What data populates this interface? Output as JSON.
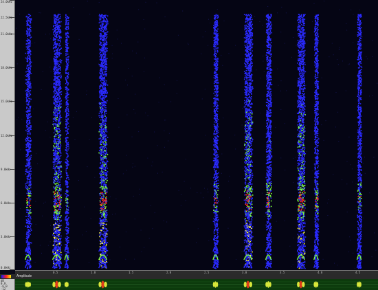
{
  "freq_ruler": {
    "labels": [
      {
        "text": "24.0kHz",
        "level": 24.0
      },
      {
        "text": "22.5kHz",
        "level": 22.5
      },
      {
        "text": "21.0kHz",
        "level": 21.0
      },
      {
        "text": "18.0kHz",
        "level": 18.0
      },
      {
        "text": "15.0kHz",
        "level": 15.0
      },
      {
        "text": "12.0kHz",
        "level": 12.0
      },
      {
        "text": "9.0kHz",
        "level": 9.0
      },
      {
        "text": "6.0kHz",
        "level": 6.0
      },
      {
        "text": "3.0kHz",
        "level": 3.0
      },
      {
        "text": "0.0kHz",
        "level": 0.0
      }
    ]
  },
  "time_ruler": {
    "labels": [
      "0.5",
      "1.0",
      "1.5",
      "2.0",
      "2.5",
      "3.0",
      "3.5",
      "4.0",
      "4.5"
    ]
  },
  "amplitude": {
    "title": "Amplitude",
    "scale": [
      "dB",
      "0.0",
      "-6.0",
      "-12"
    ]
  },
  "colors": {
    "spectro_bg": "#050514",
    "low": "#2a2aff",
    "mid": "#7cff3a",
    "high": "#ff2a1a",
    "peak": "#ffff40"
  },
  "time_range": [
    0,
    4.8
  ],
  "bursts": [
    {
      "time": 0.17,
      "strength": 0.7,
      "width": 0.08
    },
    {
      "time": 0.55,
      "strength": 1.0,
      "width": 0.12
    },
    {
      "time": 0.68,
      "strength": 0.6,
      "width": 0.05
    },
    {
      "time": 1.16,
      "strength": 1.0,
      "width": 0.12
    },
    {
      "time": 2.65,
      "strength": 0.8,
      "width": 0.07
    },
    {
      "time": 3.08,
      "strength": 1.0,
      "width": 0.12
    },
    {
      "time": 3.35,
      "strength": 0.85,
      "width": 0.08
    },
    {
      "time": 3.78,
      "strength": 1.0,
      "width": 0.11
    },
    {
      "time": 3.98,
      "strength": 0.8,
      "width": 0.06
    },
    {
      "time": 4.55,
      "strength": 0.75,
      "width": 0.06
    }
  ]
}
